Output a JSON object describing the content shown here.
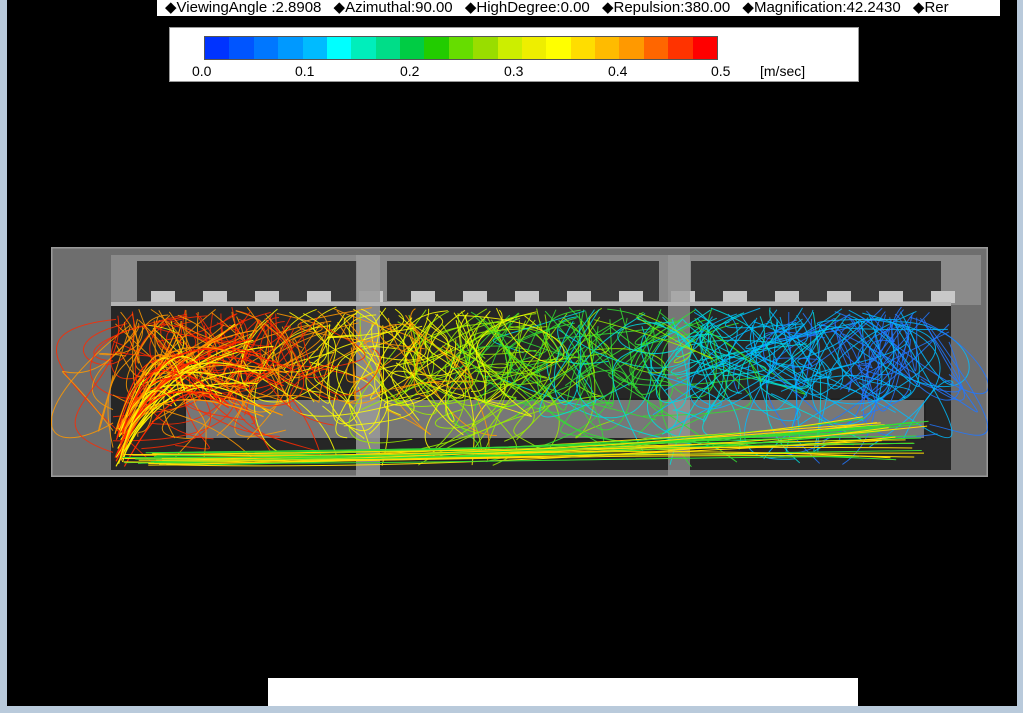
{
  "params": {
    "viewing_angle": "◆ViewingAngle :2.8908",
    "azimuthal": "◆Azimuthal:90.00",
    "high_degree": "◆HighDegree:0.00",
    "repulsion": "◆Repulsion:380.00",
    "magnification": "◆Magnification:42.2430",
    "truncated": "◆Rer"
  },
  "legend": {
    "ticks": [
      "0.0",
      "0.1",
      "0.2",
      "0.3",
      "0.4",
      "0.5"
    ],
    "unit": "[m/sec]",
    "colors": [
      "#0033ff",
      "#0055ff",
      "#0077ff",
      "#0099ff",
      "#00bbff",
      "#00ffff",
      "#00eebb",
      "#00dd88",
      "#00cc44",
      "#22cc00",
      "#66dd00",
      "#99dd00",
      "#ccee00",
      "#eeee00",
      "#ffff00",
      "#ffdd00",
      "#ffbb00",
      "#ff9900",
      "#ff6600",
      "#ff3300",
      "#ff0000"
    ]
  },
  "scene": {
    "velocity_colors": [
      "#ff2a00",
      "#ff9900",
      "#ffff00",
      "#99ee00",
      "#33dd33",
      "#00dddd",
      "#00bbff",
      "#2277ff",
      "#1144dd",
      "#3355ff"
    ],
    "wall_color": "#7f7f7f",
    "frame_color": "#5a5a5a"
  }
}
